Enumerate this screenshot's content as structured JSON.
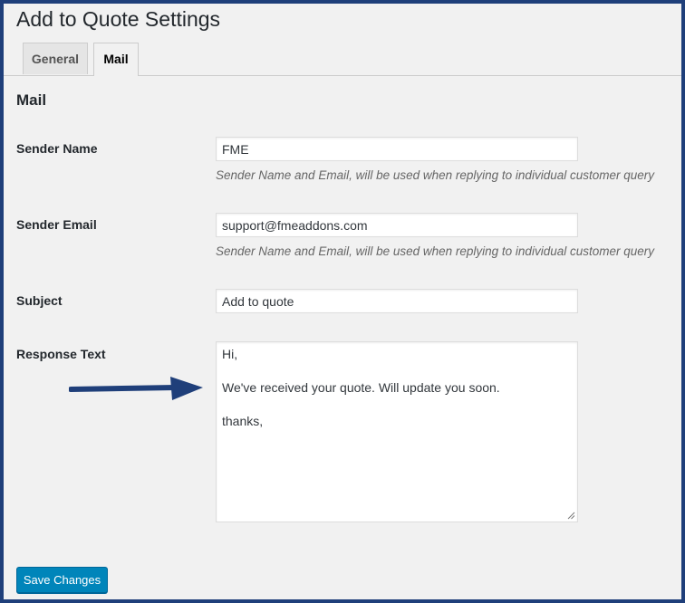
{
  "page_title": "Add to Quote Settings",
  "tabs": [
    {
      "label": "General",
      "active": false
    },
    {
      "label": "Mail",
      "active": true
    }
  ],
  "section_title": "Mail",
  "fields": {
    "sender_name": {
      "label": "Sender Name",
      "value": "FME",
      "description": "Sender Name and Email, will be used when replying to individual customer query"
    },
    "sender_email": {
      "label": "Sender Email",
      "value": "support@fmeaddons.com",
      "description": "Sender Name and Email, will be used when replying to individual customer query"
    },
    "subject": {
      "label": "Subject",
      "value": "Add to quote"
    },
    "response_text": {
      "label": "Response Text",
      "lines": [
        "Hi,",
        "",
        "We've received your quote. Will update you soon.",
        "",
        "thanks,"
      ]
    }
  },
  "annotation": {
    "icon": "arrow-right-icon",
    "color": "#1f3f7a"
  },
  "save_button_label": "Save Changes",
  "colors": {
    "accent": "#0085ba",
    "frame": "#1f3f7a",
    "background": "#f1f1f1"
  }
}
